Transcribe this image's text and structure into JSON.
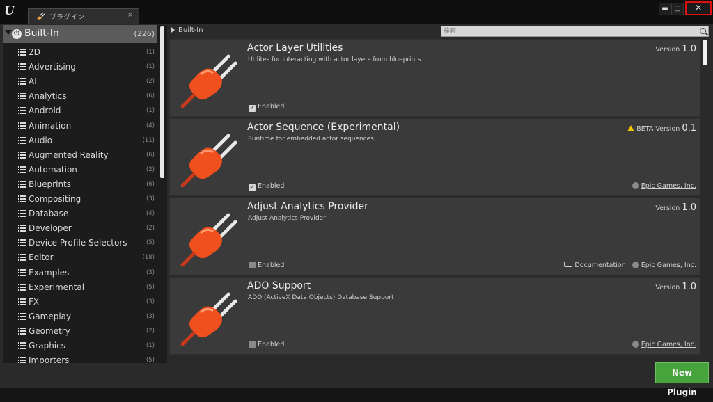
{
  "window": {
    "tab_label": "プラグイン",
    "tab_close": "×",
    "minimize": "▬",
    "maximize": "□",
    "close": "✕"
  },
  "sidebar": {
    "header": {
      "label": "Built-In",
      "count": "(226)"
    },
    "categories": [
      {
        "label": "2D",
        "count": "(1)"
      },
      {
        "label": "Advertising",
        "count": "(1)"
      },
      {
        "label": "AI",
        "count": "(2)"
      },
      {
        "label": "Analytics",
        "count": "(6)"
      },
      {
        "label": "Android",
        "count": "(1)"
      },
      {
        "label": "Animation",
        "count": "(4)"
      },
      {
        "label": "Audio",
        "count": "(11)"
      },
      {
        "label": "Augmented Reality",
        "count": "(6)"
      },
      {
        "label": "Automation",
        "count": "(2)"
      },
      {
        "label": "Blueprints",
        "count": "(6)"
      },
      {
        "label": "Compositing",
        "count": "(3)"
      },
      {
        "label": "Database",
        "count": "(4)"
      },
      {
        "label": "Developer",
        "count": "(2)"
      },
      {
        "label": "Device Profile Selectors",
        "count": "(5)"
      },
      {
        "label": "Editor",
        "count": "(18)"
      },
      {
        "label": "Examples",
        "count": "(3)"
      },
      {
        "label": "Experimental",
        "count": "(5)"
      },
      {
        "label": "FX",
        "count": "(3)"
      },
      {
        "label": "Gameplay",
        "count": "(3)"
      },
      {
        "label": "Geometry",
        "count": "(2)"
      },
      {
        "label": "Graphics",
        "count": "(1)"
      },
      {
        "label": "Importers",
        "count": "(5)"
      }
    ]
  },
  "breadcrumb": "Built-In",
  "search": {
    "placeholder": "検索",
    "value": ""
  },
  "plugins": [
    {
      "name": "Actor Layer Utilities",
      "description": "Utilites for interacting with actor layers from blueprints",
      "version_label": "Version",
      "version": "1.0",
      "beta": "",
      "enabled_label": "Enabled",
      "enabled": true,
      "documentation": "",
      "vendor": ""
    },
    {
      "name": "Actor Sequence (Experimental)",
      "description": "Runtime for embedded actor sequences",
      "version_label": "BETA Version",
      "version": "0.1",
      "beta": "yes",
      "enabled_label": "Enabled",
      "enabled": true,
      "documentation": "",
      "vendor": "Epic Games, Inc."
    },
    {
      "name": "Adjust Analytics Provider",
      "description": "Adjust Analytics Provider",
      "version_label": "Version",
      "version": "1.0",
      "beta": "",
      "enabled_label": "Enabled",
      "enabled": false,
      "documentation": "Documentation",
      "vendor": "Epic Games, Inc."
    },
    {
      "name": "ADO Support",
      "description": "ADO (ActiveX Data Objects) Database Support",
      "version_label": "Version",
      "version": "1.0",
      "beta": "",
      "enabled_label": "Enabled",
      "enabled": false,
      "documentation": "",
      "vendor": "Epic Games, Inc."
    }
  ],
  "new_plugin_button": "New Plugin",
  "colors": {
    "accent_green": "#47a33c",
    "plug_orange": "#f0501e",
    "close_highlight": "#e01010"
  }
}
